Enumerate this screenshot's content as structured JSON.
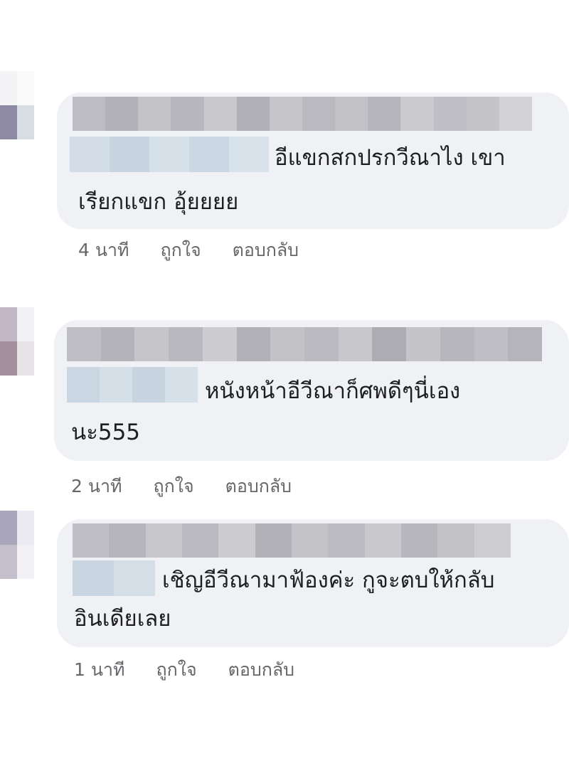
{
  "comments": [
    {
      "line1": "อีแขกสกปรกวีณาไง เขา",
      "line2": "เรียกแขก อุ้ยยยย",
      "time": "4 นาที",
      "like_label": "ถูกใจ",
      "reply_label": "ตอบกลับ"
    },
    {
      "line1": "หนังหน้าอีวีณาก็ศพดีๆนี่เอง",
      "line2": "นะ555",
      "time": "2 นาที",
      "like_label": "ถูกใจ",
      "reply_label": "ตอบกลับ"
    },
    {
      "line1": "เชิญอีวีณามาฟ้องค่ะ กูจะตบให้กลับ",
      "line2": "อินเดียเลย",
      "time": "1 นาที",
      "like_label": "ถูกใจ",
      "reply_label": "ตอบกลับ"
    }
  ],
  "colors": {
    "bubble": "#f0f1f5",
    "text": "#1c1e21",
    "meta": "#65676b",
    "blur_name": "#b9b9bf",
    "blur_mention": "#cfdbe6"
  }
}
